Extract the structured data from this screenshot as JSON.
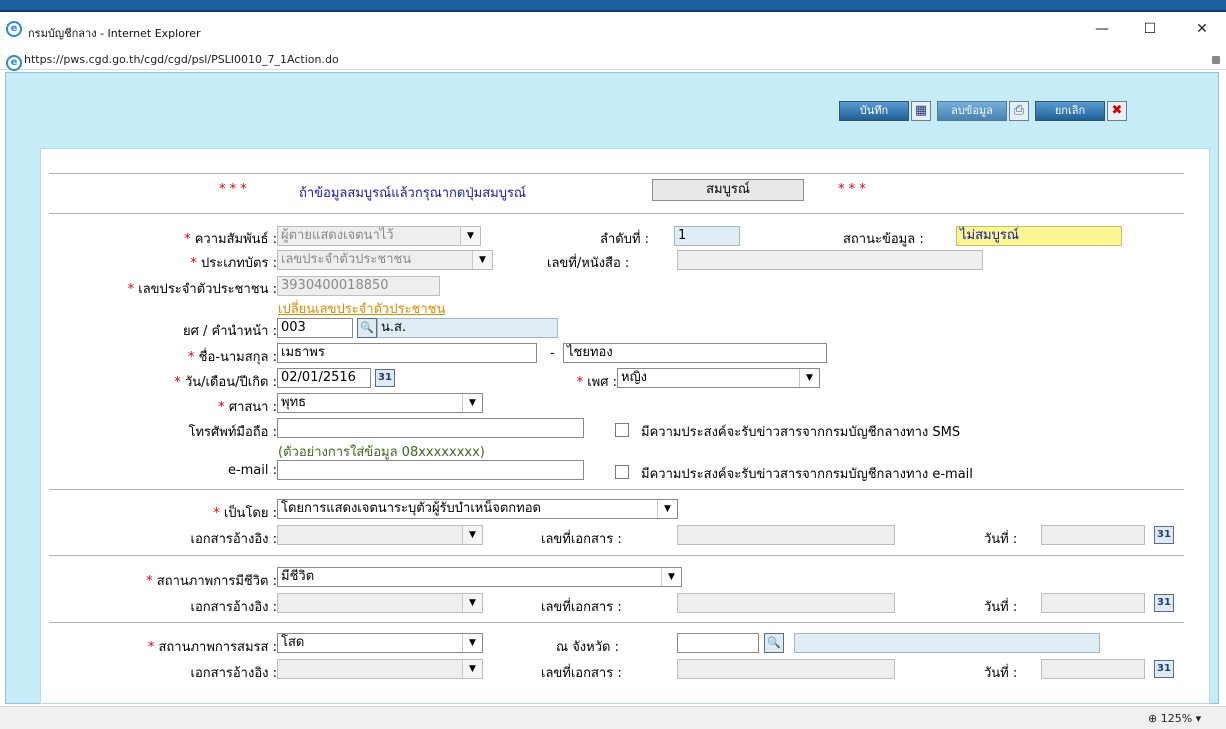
{
  "window": {
    "title": "กรมบัญชีกลาง - Internet Explorer",
    "url": "https://pws.cgd.go.th/cgd/cgd/psl/PSLI0010_7_1Action.do",
    "minimize": "—",
    "maximize": "☐",
    "close": "✕",
    "zoom": "125%",
    "zoom_arrow": "▾"
  },
  "toolbar": {
    "save_label": "บันทึก",
    "save_icon": "floppy-disk-icon",
    "delete_label": "ลบข้อมูล",
    "print_icon": "printer-icon",
    "cancel_label": "ยกเลิก",
    "close_icon": "close-icon"
  },
  "notice": {
    "stars_left": "* * *",
    "text": "ถ้าข้อมูลสมบูรณ์แล้วกรุณากดปุ่มสมบูรณ์",
    "complete_button": "สมบูรณ์",
    "stars_right": "* * *"
  },
  "req_mark": "*",
  "form": {
    "relation_label": "ความสัมพันธ์ :",
    "relation_value": "ผู้ตายแสดงเจตนาไว้",
    "order_label": "ลำดับที่ :",
    "order_value": "1",
    "status_label": "สถานะข้อมูล :",
    "status_value": "ไม่สมบูรณ์",
    "card_type_label": "ประเภทบัตร :",
    "card_type_value": "เลขประจำตัวประชาชน",
    "doc_no_label": "เลขที่/หนังสือ :",
    "doc_no_value": "",
    "id_label": "เลขประจำตัวประชาชน :",
    "id_value": "3930400018850",
    "change_id_link": "เปลี่ยนเลขประจำตัวประชาชน",
    "title_label": "ยศ / คำนำหน้า :",
    "title_code": "003",
    "title_value": "น.ส.",
    "name_label": "ชื่อ-นามสกุล :",
    "first_name": "เมธาพร",
    "name_dash": "-",
    "last_name": "ไชยทอง",
    "dob_label": "วัน/เดือน/ปีเกิด :",
    "dob_value": "02/01/2516",
    "gender_label": "เพศ :",
    "gender_value": "หญิง",
    "religion_label": "ศาสนา :",
    "religion_value": "พุทธ",
    "phone_label": "โทรศัพท์มือถือ :",
    "phone_value": "",
    "phone_hint": "(ตัวอย่างการใส่ข้อมูล 08xxxxxxxx)",
    "sms_label": "มีความประสงค์จะรับข่าวสารจากกรมบัญชีกลางทาง SMS",
    "email_label": "e-mail :",
    "email_value": "",
    "email_opt_label": "มีความประสงค์จะรับข่าวสารจากกรมบัญชีกลางทาง e-mail"
  },
  "section_by": {
    "by_label": "เป็นโดย :",
    "by_value": "โดยการแสดงเจตนาระบุตัวผู้รับบำเหน็จตกทอด",
    "ref_label": "เอกสารอ้างอิง :",
    "doc_label": "เลขที่เอกสาร :",
    "date_label": "วันที่ :"
  },
  "section_life": {
    "life_label": "สถานภาพการมีชีวิต :",
    "life_value": "มีชีวิต",
    "ref_label": "เอกสารอ้างอิง :",
    "doc_label": "เลขที่เอกสาร :",
    "date_label": "วันที่ :"
  },
  "section_marriage": {
    "marriage_label": "สถานภาพการสมรส :",
    "marriage_value": "โสด",
    "province_label": "ณ จังหวัด :",
    "ref_label": "เอกสารอ้างอิง :",
    "doc_label": "เลขที่เอกสาร :",
    "date_label": "วันที่ :"
  },
  "calendar_text": "31"
}
